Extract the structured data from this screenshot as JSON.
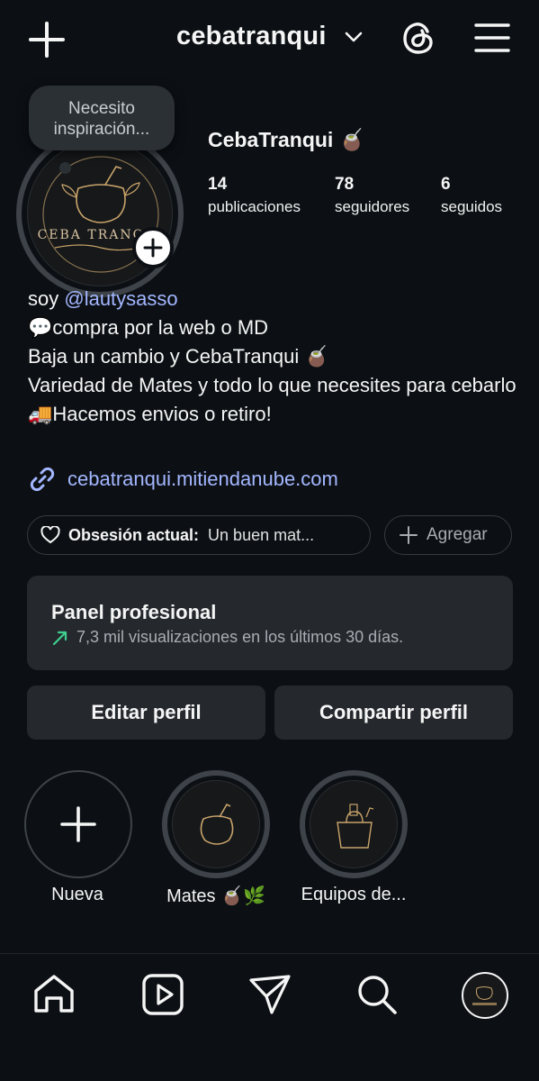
{
  "header": {
    "username": "cebatranqui",
    "icons": [
      "plus-icon",
      "chevron-down-icon",
      "threads-icon",
      "menu-icon"
    ]
  },
  "profile": {
    "note_bubble": "Necesito inspiración...",
    "display_name": "CebaTranqui 🧉",
    "stats": [
      {
        "value": "14",
        "label": "publicaciones"
      },
      {
        "value": "78",
        "label": "seguidores"
      },
      {
        "value": "6",
        "label": "seguidos"
      }
    ],
    "avatar_text": "CEBA TRANQUI"
  },
  "bio": {
    "line1_prefix": "soy ",
    "line1_mention": "@lautysasso",
    "line2": "💬compra por la web o MD",
    "line3": "Baja un cambio y CebaTranqui 🧉",
    "line4": "Variedad de Mates y todo lo que necesites para cebarlo",
    "line5": "🚚Hacemos envios o retiro!",
    "link": "cebatranqui.mitiendanube.com"
  },
  "notes": {
    "obsession_label": "Obsesión actual:",
    "obsession_value": "Un buen mat...",
    "add_label": "Agregar"
  },
  "panel": {
    "title": "Panel profesional",
    "subtitle": "7,3 mil visualizaciones en los últimos 30 días.",
    "accent": "#3ecf8e"
  },
  "buttons": {
    "edit": "Editar perfil",
    "share": "Compartir perfil"
  },
  "highlights": [
    {
      "label": "Nueva"
    },
    {
      "label": "Mates 🧉🌿"
    },
    {
      "label": "Equipos de..."
    }
  ],
  "nav": [
    "home-icon",
    "reels-icon",
    "direct-icon",
    "search-icon",
    "profile-avatar"
  ],
  "colors": {
    "background": "#0c1014",
    "surface": "#25292e",
    "link": "#a3b6ff"
  }
}
